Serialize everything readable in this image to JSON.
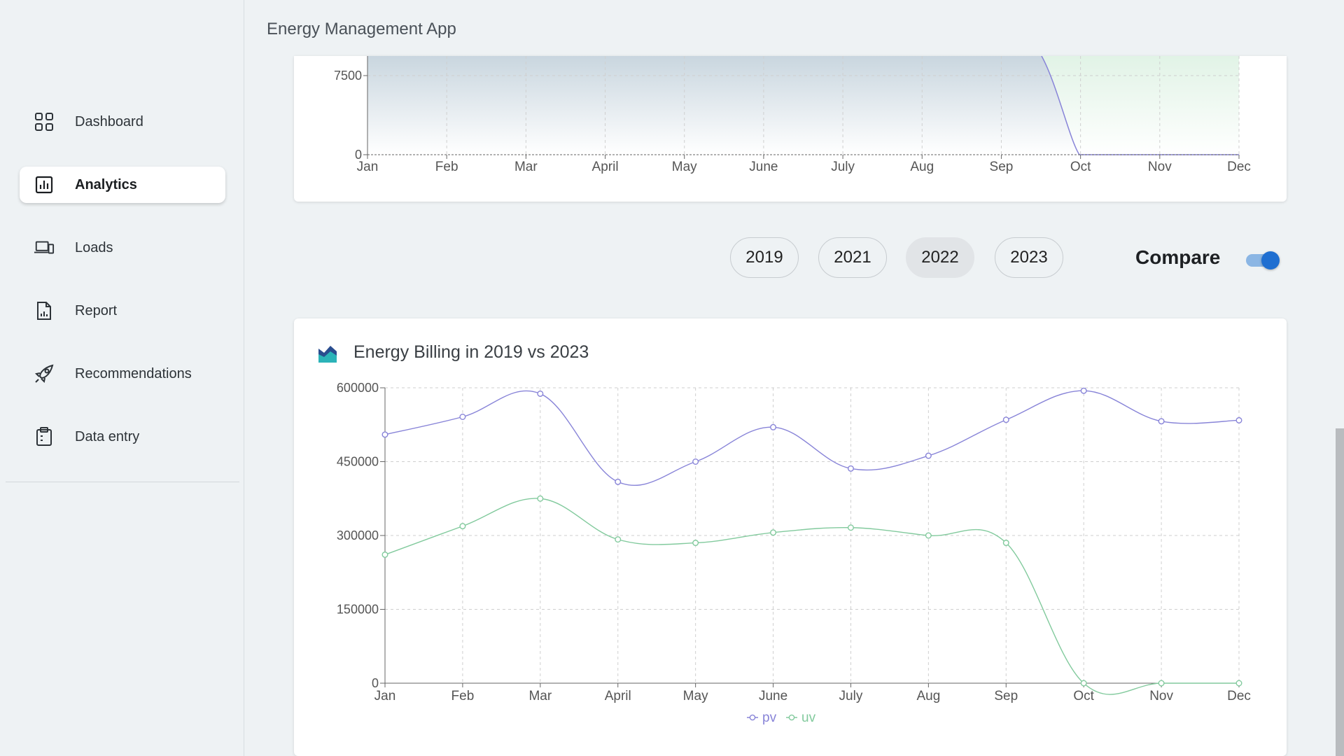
{
  "app": {
    "title": "Energy Management App"
  },
  "sidebar": {
    "items": [
      {
        "label": "Dashboard",
        "icon": "grid-icon",
        "active": false
      },
      {
        "label": "Analytics",
        "icon": "bar-chart-icon",
        "active": true
      },
      {
        "label": "Loads",
        "icon": "devices-icon",
        "active": false
      },
      {
        "label": "Report",
        "icon": "report-icon",
        "active": false
      },
      {
        "label": "Recommendations",
        "icon": "rocket-icon",
        "active": false
      },
      {
        "label": "Data entry",
        "icon": "clipboard-icon",
        "active": false
      }
    ]
  },
  "years": {
    "options": [
      "2019",
      "2021",
      "2022",
      "2023"
    ],
    "selected": "2022"
  },
  "compare": {
    "label": "Compare",
    "enabled": true
  },
  "colors": {
    "pv": "#8884d8",
    "uv": "#82ca9d",
    "accent": "#1f6fd1"
  },
  "chart_data": [
    {
      "type": "area",
      "title": "",
      "categories": [
        "Jan",
        "Feb",
        "Mar",
        "April",
        "May",
        "June",
        "July",
        "Aug",
        "Sep",
        "Oct",
        "Nov",
        "Dec"
      ],
      "y_ticks": [
        "7500",
        "0"
      ],
      "series": [
        {
          "name": "",
          "values": [
            null,
            null,
            null,
            null,
            null,
            null,
            null,
            null,
            10000,
            0,
            0,
            0
          ]
        },
        {
          "name": "",
          "values": [
            null,
            null,
            null,
            null,
            null,
            null,
            null,
            null,
            null,
            null,
            null,
            null
          ]
        }
      ],
      "grid": true
    },
    {
      "type": "line",
      "title": "Energy Billing in 2019 vs 2023",
      "categories": [
        "Jan",
        "Feb",
        "Mar",
        "April",
        "May",
        "June",
        "July",
        "Aug",
        "Sep",
        "Oct",
        "Nov",
        "Dec"
      ],
      "ylim": [
        0,
        600000
      ],
      "y_ticks": [
        "600000",
        "450000",
        "300000",
        "150000",
        "0"
      ],
      "series": [
        {
          "name": "pv",
          "values": [
            505000,
            541000,
            588000,
            409000,
            450000,
            520000,
            436000,
            462000,
            535000,
            594000,
            532000,
            534000
          ]
        },
        {
          "name": "uv",
          "values": [
            261000,
            319000,
            375000,
            292000,
            285000,
            306000,
            316000,
            300000,
            285000,
            0,
            0,
            0
          ]
        }
      ],
      "legend_position": "bottom",
      "grid": true
    }
  ]
}
